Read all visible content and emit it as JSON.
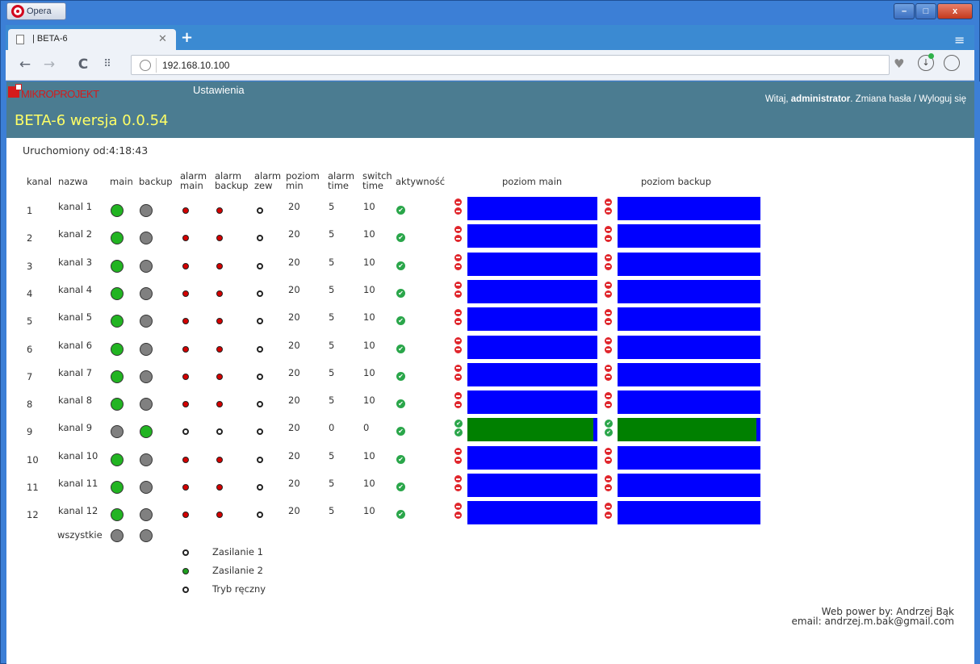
{
  "browser": {
    "app_label": "Opera",
    "tab_title": "| BETA-6",
    "url": "192.168.10.100",
    "window_buttons": {
      "minimize": "–",
      "maximize": "□",
      "close": "x"
    }
  },
  "header": {
    "logo_text": "MIKROPROJEKT",
    "menu_settings": "Ustawienia",
    "title": "BETA-6 wersja 0.0.54",
    "greeting": "Witaj, ",
    "username": "administrator",
    "user_links": ". Zmiana hasła / Wyloguj się"
  },
  "uptime": "Uruchomiony od:4:18:43",
  "columns": {
    "kanal": "kanal",
    "nazwa": "nazwa",
    "main": "main",
    "backup": "backup",
    "alarm_main": [
      "alarm",
      "main"
    ],
    "alarm_backup": [
      "alarm",
      "backup"
    ],
    "alarm_zew": [
      "alarm",
      "zew"
    ],
    "poziom_min": [
      "poziom",
      "min"
    ],
    "alarm_time": [
      "alarm",
      "time"
    ],
    "switch_time": [
      "switch",
      "time"
    ],
    "aktywnosc": "aktywność",
    "poziom_main": "poziom main",
    "poziom_backup": "poziom backup"
  },
  "channels": [
    {
      "num": "1",
      "name": "kanal 1",
      "main": "green",
      "backup": "gray",
      "alarm_main": "red",
      "alarm_backup": "red",
      "alarm_zew": "open",
      "poziom_min": "20",
      "alarm_time": "5",
      "switch_time": "10",
      "level_main": 0,
      "level_backup": 0
    },
    {
      "num": "2",
      "name": "kanal 2",
      "main": "green",
      "backup": "gray",
      "alarm_main": "red",
      "alarm_backup": "red",
      "alarm_zew": "open",
      "poziom_min": "20",
      "alarm_time": "5",
      "switch_time": "10",
      "level_main": 0,
      "level_backup": 0
    },
    {
      "num": "3",
      "name": "kanal 3",
      "main": "green",
      "backup": "gray",
      "alarm_main": "red",
      "alarm_backup": "red",
      "alarm_zew": "open",
      "poziom_min": "20",
      "alarm_time": "5",
      "switch_time": "10",
      "level_main": 0,
      "level_backup": 0
    },
    {
      "num": "4",
      "name": "kanal 4",
      "main": "green",
      "backup": "gray",
      "alarm_main": "red",
      "alarm_backup": "red",
      "alarm_zew": "open",
      "poziom_min": "20",
      "alarm_time": "5",
      "switch_time": "10",
      "level_main": 0,
      "level_backup": 0
    },
    {
      "num": "5",
      "name": "kanal 5",
      "main": "green",
      "backup": "gray",
      "alarm_main": "red",
      "alarm_backup": "red",
      "alarm_zew": "open",
      "poziom_min": "20",
      "alarm_time": "5",
      "switch_time": "10",
      "level_main": 0,
      "level_backup": 0
    },
    {
      "num": "6",
      "name": "kanal 6",
      "main": "green",
      "backup": "gray",
      "alarm_main": "red",
      "alarm_backup": "red",
      "alarm_zew": "open",
      "poziom_min": "20",
      "alarm_time": "5",
      "switch_time": "10",
      "level_main": 0,
      "level_backup": 0
    },
    {
      "num": "7",
      "name": "kanal 7",
      "main": "green",
      "backup": "gray",
      "alarm_main": "red",
      "alarm_backup": "red",
      "alarm_zew": "open",
      "poziom_min": "20",
      "alarm_time": "5",
      "switch_time": "10",
      "level_main": 0,
      "level_backup": 0
    },
    {
      "num": "8",
      "name": "kanal 8",
      "main": "green",
      "backup": "gray",
      "alarm_main": "red",
      "alarm_backup": "red",
      "alarm_zew": "open",
      "poziom_min": "20",
      "alarm_time": "5",
      "switch_time": "10",
      "level_main": 0,
      "level_backup": 0
    },
    {
      "num": "9",
      "name": "kanal 9",
      "main": "gray",
      "backup": "green",
      "alarm_main": "open",
      "alarm_backup": "open",
      "alarm_zew": "open",
      "poziom_min": "20",
      "alarm_time": "0",
      "switch_time": "0",
      "level_main": 0.97,
      "level_backup": 0.97
    },
    {
      "num": "10",
      "name": "kanal 10",
      "main": "green",
      "backup": "gray",
      "alarm_main": "red",
      "alarm_backup": "red",
      "alarm_zew": "open",
      "poziom_min": "20",
      "alarm_time": "5",
      "switch_time": "10",
      "level_main": 0,
      "level_backup": 0
    },
    {
      "num": "11",
      "name": "kanal 11",
      "main": "green",
      "backup": "gray",
      "alarm_main": "red",
      "alarm_backup": "red",
      "alarm_zew": "open",
      "poziom_min": "20",
      "alarm_time": "5",
      "switch_time": "10",
      "level_main": 0,
      "level_backup": 0
    },
    {
      "num": "12",
      "name": "kanal 12",
      "main": "green",
      "backup": "gray",
      "alarm_main": "red",
      "alarm_backup": "red",
      "alarm_zew": "open",
      "poziom_min": "20",
      "alarm_time": "5",
      "switch_time": "10",
      "level_main": 0,
      "level_backup": 0
    }
  ],
  "all_label": "wszystkie",
  "legend": [
    {
      "label": "Zasilanie 1",
      "state": "open"
    },
    {
      "label": "Zasilanie 2",
      "state": "green"
    },
    {
      "label": "Tryb ręczny",
      "state": "open"
    }
  ],
  "footer": {
    "line1": "Web power by: Andrzej Bąk",
    "line2": "email: andrzej.m.bak@gmail.com"
  },
  "colors": {
    "header_bg": "#4b7c91",
    "title": "#ffff66",
    "level_bar": "#0000ff",
    "level_fill": "#008000",
    "led_green": "#22b422",
    "led_gray": "#808080"
  }
}
